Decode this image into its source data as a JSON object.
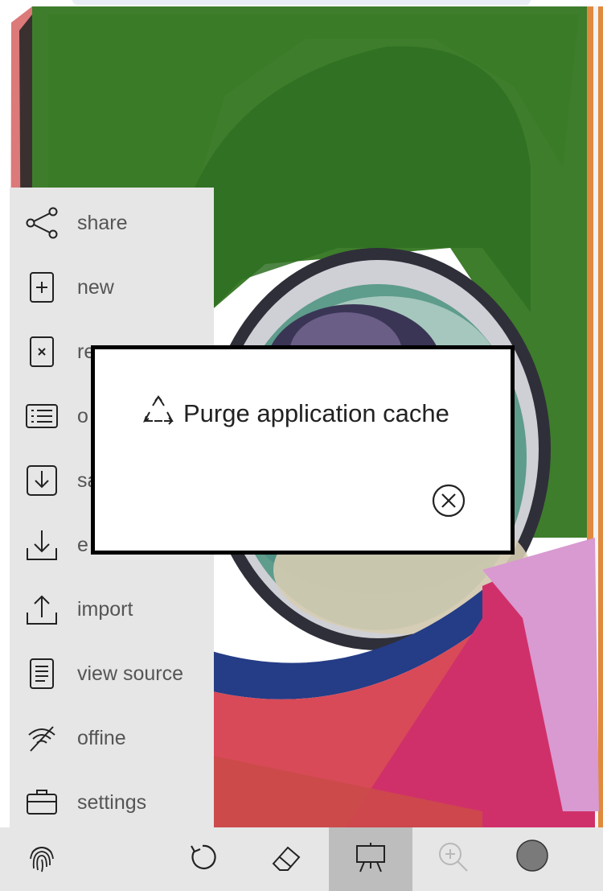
{
  "menu": {
    "items": [
      {
        "label": "share",
        "icon": "share-icon"
      },
      {
        "label": "new",
        "icon": "new-file-icon"
      },
      {
        "label": "re",
        "icon": "reset-file-icon"
      },
      {
        "label": "o",
        "icon": "list-icon"
      },
      {
        "label": "sa",
        "icon": "save-icon"
      },
      {
        "label": "e",
        "icon": "export-icon"
      },
      {
        "label": "import",
        "icon": "import-icon"
      },
      {
        "label": "view source",
        "icon": "document-icon"
      },
      {
        "label": "offine",
        "icon": "offline-icon"
      },
      {
        "label": "settings",
        "icon": "briefcase-icon"
      }
    ]
  },
  "dialog": {
    "action_label": "Purge application cache",
    "action_icon": "recycle-icon",
    "close_icon": "close-circle-icon"
  },
  "toolbar": {
    "items": [
      {
        "icon": "fingerprint-icon"
      },
      {
        "icon": "undo-icon"
      },
      {
        "icon": "eraser-icon"
      },
      {
        "icon": "easel-icon",
        "active": true
      },
      {
        "icon": "zoom-in-icon",
        "disabled": true
      },
      {
        "icon": "color-swatch-icon",
        "color": "#7a7a7a"
      }
    ]
  },
  "colors": {
    "menu_bg": "#e6e6e6",
    "active_tool_bg": "#bdbdbd",
    "canvas_green": "#3d7a2a",
    "canvas_pink": "#d23868"
  }
}
